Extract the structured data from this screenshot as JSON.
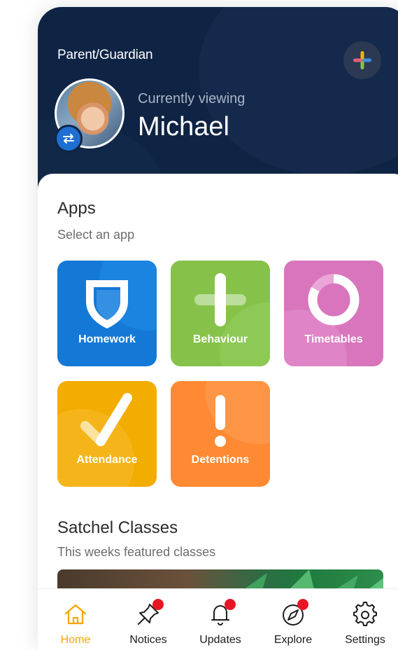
{
  "header": {
    "role": "Parent/Guardian",
    "viewing_label": "Currently viewing",
    "child_name": "Michael"
  },
  "apps_section": {
    "title": "Apps",
    "subtitle": "Select an app",
    "apps": [
      {
        "label": "Homework",
        "color": "#1479d6",
        "icon": "shield-icon"
      },
      {
        "label": "Behaviour",
        "color": "#86c24a",
        "icon": "plus-icon"
      },
      {
        "label": "Timetables",
        "color": "#d975bd",
        "icon": "ring-icon"
      },
      {
        "label": "Attendance",
        "color": "#f3ac00",
        "icon": "check-icon"
      },
      {
        "label": "Detentions",
        "color": "#ff8a33",
        "icon": "exclamation-icon"
      }
    ]
  },
  "classes_section": {
    "title": "Satchel Classes",
    "subtitle": "This weeks featured classes"
  },
  "tabbar": {
    "tabs": [
      {
        "label": "Home",
        "icon": "home-icon",
        "active": true,
        "badge": false
      },
      {
        "label": "Notices",
        "icon": "pin-icon",
        "active": false,
        "badge": true
      },
      {
        "label": "Updates",
        "icon": "bell-icon",
        "active": false,
        "badge": true
      },
      {
        "label": "Explore",
        "icon": "compass-icon",
        "active": false,
        "badge": true
      },
      {
        "label": "Settings",
        "icon": "gear-icon",
        "active": false,
        "badge": false
      }
    ]
  },
  "colors": {
    "header_bg": "#0f2444",
    "active_tab": "#f5a400",
    "badge": "#e81625"
  }
}
